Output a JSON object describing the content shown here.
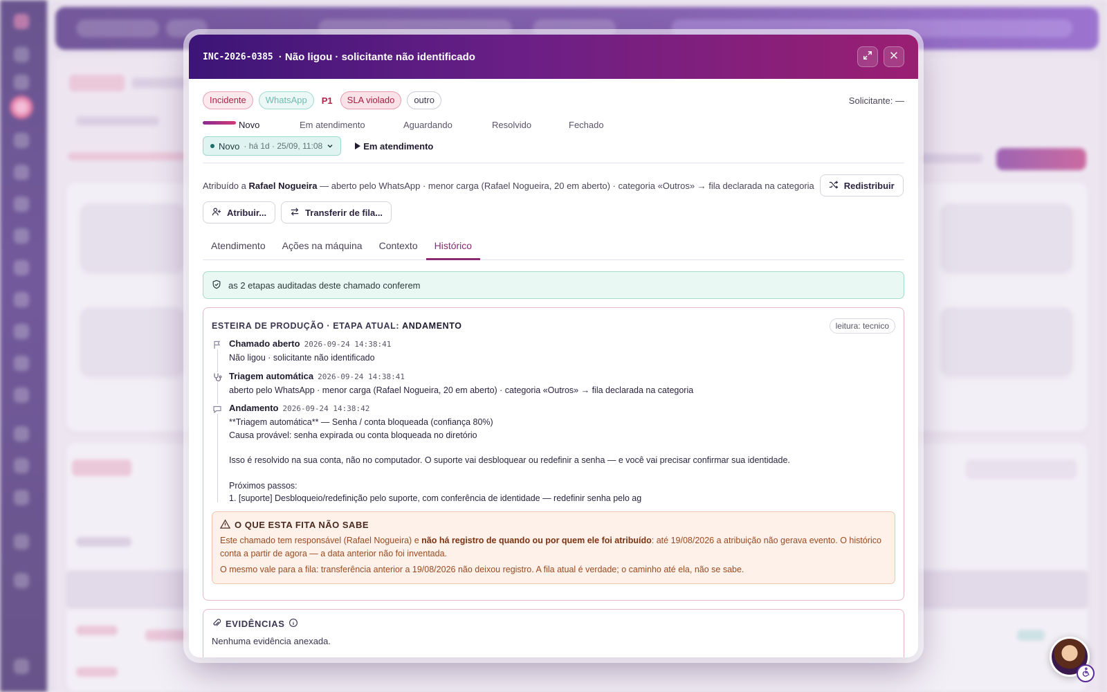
{
  "modal": {
    "code": "INC-2026-0385",
    "title": "· Não ligou · solicitante não identificado",
    "tags": {
      "type": "Incidente",
      "channel": "WhatsApp",
      "priority": "P1",
      "sla": "SLA violado",
      "category": "outro"
    },
    "requester": "Solicitante: —",
    "steps": [
      "Novo",
      "Em atendimento",
      "Aguardando",
      "Resolvido",
      "Fechado"
    ],
    "status": {
      "label": "Novo",
      "detail": "· há 1d · 25/09, 11:08",
      "next_action": "Em atendimento"
    },
    "assignment": {
      "prefix": "Atribuído a",
      "assignee": "Rafael Nogueira",
      "detail": "— aberto pelo WhatsApp · menor carga (Rafael Nogueira, 20 em aberto) · categoria «Outros» → fila declarada na categoria",
      "redistribute": "Redistribuir",
      "assign": "Atribuir...",
      "transfer": "Transferir de fila..."
    },
    "tabs": [
      "Atendimento",
      "Ações na máquina",
      "Contexto",
      "Histórico"
    ],
    "active_tab": "Histórico",
    "audit_ok": "as 2 etapas auditadas deste chamado conferem",
    "pipeline": {
      "title_prefix": "Esteira de produção · etapa atual: ",
      "title_stage": "Andamento",
      "badge": "leitura: tecnico",
      "events": [
        {
          "title": "Chamado aberto",
          "time": "2026-09-24 14:38:41",
          "icon": "flag-icon",
          "lines": [
            "Não ligou · solicitante não identificado"
          ]
        },
        {
          "title": "Triagem automática",
          "time": "2026-09-24 14:38:41",
          "icon": "stethoscope-icon",
          "lines": [
            "aberto pelo WhatsApp · menor carga (Rafael Nogueira, 20 em aberto) · categoria «Outros» → fila declarada na categoria"
          ]
        },
        {
          "title": "Andamento",
          "time": "2026-09-24 14:38:42",
          "icon": "comment-icon",
          "lines": [
            "**Triagem automática** — Senha / conta bloqueada (confiança 80%)",
            "Causa provável: senha expirada ou conta bloqueada no diretório",
            "",
            "Isso é resolvido na sua conta, não no computador. O suporte vai desbloquear ou redefinir a senha — e você vai precisar confirmar sua identidade.",
            "",
            "Próximos passos:",
            "1. [suporte] Desbloqueio/redefinição pelo suporte, com conferência de identidade — redefinir senha pelo ag"
          ]
        }
      ],
      "warning": {
        "title": "O QUE ESTA FITA NÃO SABE",
        "p1_a": "Este chamado tem responsável (Rafael Nogueira) e ",
        "p1_b": "não há registro de quando ou por quem ele foi atribuído",
        "p1_c": ": até 19/08/2026 a atribuição não gerava evento. O histórico conta a partir de agora — a data anterior não foi inventada.",
        "p2": "O mesmo vale para a fila: transferência anterior a 19/08/2026 não deixou registro. A fila atual é verdade; o caminho até ela, não se sabe."
      }
    },
    "evidence": {
      "title": "EVIDÊNCIAS",
      "empty": "Nenhuma evidência anexada."
    }
  },
  "colors": {
    "accent": "#8a2a72",
    "header_start": "#3c1577",
    "header_end": "#9a1f72",
    "ok_bg": "#eaf8f4",
    "warn_bg": "#fdf1ea"
  }
}
